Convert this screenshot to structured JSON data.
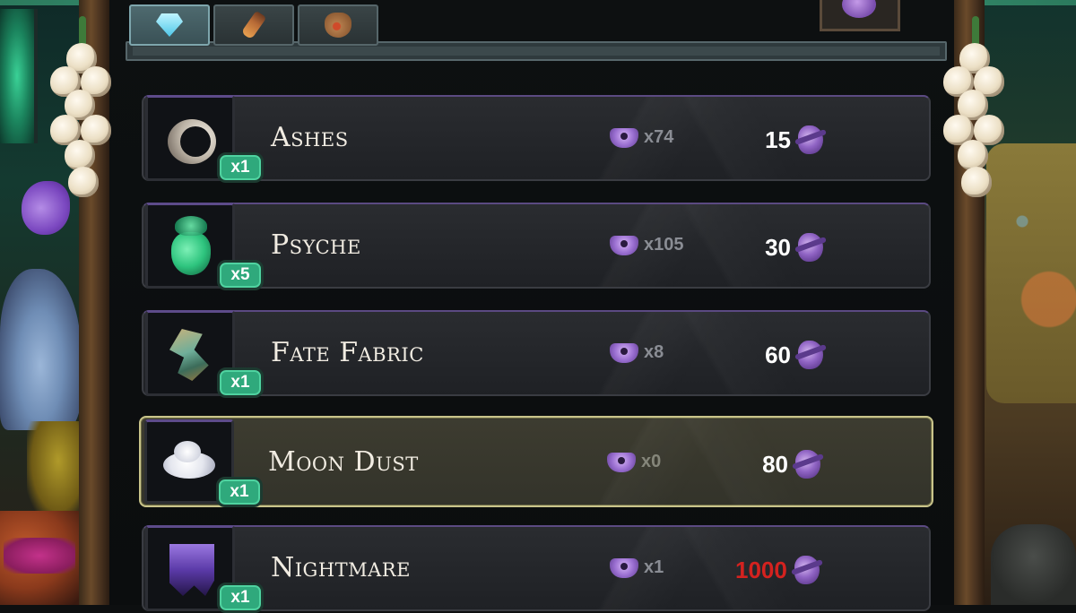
{
  "tabs": [
    {
      "icon": "gem-icon",
      "active": true
    },
    {
      "icon": "bottle-icon",
      "active": false
    },
    {
      "icon": "pouch-icon",
      "active": false
    }
  ],
  "items": [
    {
      "name": "Ashes",
      "badge": "x1",
      "owned": "x74",
      "price": "15",
      "icon": "ashes-icon",
      "selected": false,
      "affordable": true
    },
    {
      "name": "Psyche",
      "badge": "x5",
      "owned": "x105",
      "price": "30",
      "icon": "psyche-icon",
      "selected": false,
      "affordable": true
    },
    {
      "name": "Fate Fabric",
      "badge": "x1",
      "owned": "x8",
      "price": "60",
      "icon": "fate-fabric-icon",
      "selected": false,
      "affordable": true
    },
    {
      "name": "Moon Dust",
      "badge": "x1",
      "owned": "x0",
      "price": "80",
      "icon": "moon-dust-icon",
      "selected": true,
      "affordable": true
    },
    {
      "name": "Nightmare",
      "badge": "x1",
      "owned": "x1",
      "price": "1000",
      "icon": "nightmare-icon",
      "selected": false,
      "affordable": false
    }
  ],
  "colors": {
    "badge": "#2fa97c",
    "selected_border": "#c9c48a",
    "unaffordable_price": "#d4221f",
    "row_bg": "#25272b"
  }
}
